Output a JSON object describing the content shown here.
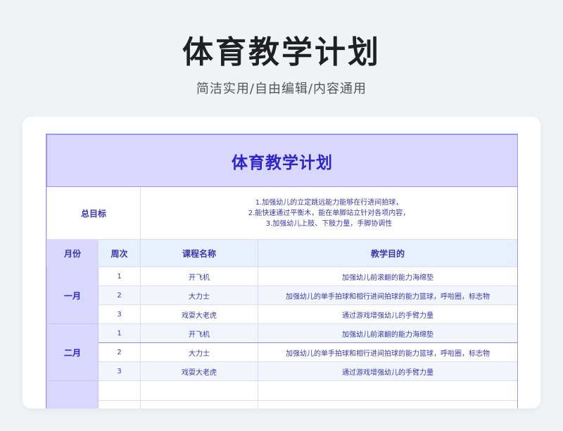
{
  "header": {
    "title": "体育教学计划",
    "subtitle": "简洁实用/自由编辑/内容通用"
  },
  "document": {
    "title": "体育教学计划",
    "goal_label": "总目标",
    "goal_lines": [
      "1.加强幼儿的立定跳远能力能够在行进间拍球，",
      "2.能快速通过平衡木，能在单脚站立针对各项内容，",
      "3.加强幼儿上肢、下肢力量，手脚协调性"
    ],
    "columns": [
      "月份",
      "周次",
      "课程名称",
      "教学目的"
    ],
    "months": [
      {
        "name": "一月",
        "rows": [
          {
            "week": "1",
            "course": "开飞机",
            "purpose": "加强幼儿前滚翻的能力海绵垫"
          },
          {
            "week": "2",
            "course": "大力士",
            "purpose": "加强幼儿的单手拍球和相行进间拍球的能力篮球，呼啦圈，标志物"
          },
          {
            "week": "3",
            "course": "戏耍大老虎",
            "purpose": "通过游戏增强幼儿的手臂力量"
          }
        ]
      },
      {
        "name": "二月",
        "rows": [
          {
            "week": "1",
            "course": "开飞机",
            "purpose": "加强幼儿前滚翻的能力海绵垫"
          },
          {
            "week": "2",
            "course": "大力士",
            "purpose": "加强幼儿的单手拍球和相行进间拍球的能力篮球，呼啦圈，标志物"
          },
          {
            "week": "3",
            "course": "戏耍大老虎",
            "purpose": "通过游戏增强幼儿的手臂力量"
          }
        ]
      }
    ]
  },
  "colors": {
    "accent": "#2f24c8",
    "header_fill": "#d9d7fb",
    "column_header_fill": "#e8effd",
    "row_alt_fill": "#f2f6fc",
    "page_bg": "#f1f2f6"
  }
}
